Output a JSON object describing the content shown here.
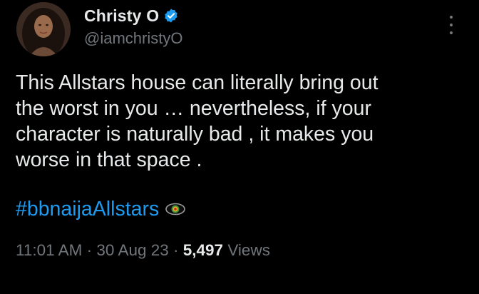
{
  "author": {
    "display_name": "Christy O",
    "handle": "@iamchristyO",
    "verified_icon": "verified-badge-icon",
    "avatar_icon": "profile-photo"
  },
  "more_icon": "more-vertical-icon",
  "tweet": {
    "lines": [
      "This Allstars house can literally bring out",
      "the worst in you … nevertheless, if your",
      "character is naturally bad , it makes you",
      "worse in that space ."
    ],
    "hashtag": "#bbnaijaAllstars",
    "hashflag_icon": "bbnaija-eye-icon"
  },
  "meta": {
    "time": "11:01 AM",
    "separator1": " · ",
    "date": "30 Aug 23",
    "separator2": " · ",
    "views_count": "5,497",
    "views_label": " Views"
  },
  "colors": {
    "background": "#000000",
    "text": "#e7e9ea",
    "muted": "#71767b",
    "link": "#1d9bf0",
    "verified": "#1d9bf0"
  }
}
